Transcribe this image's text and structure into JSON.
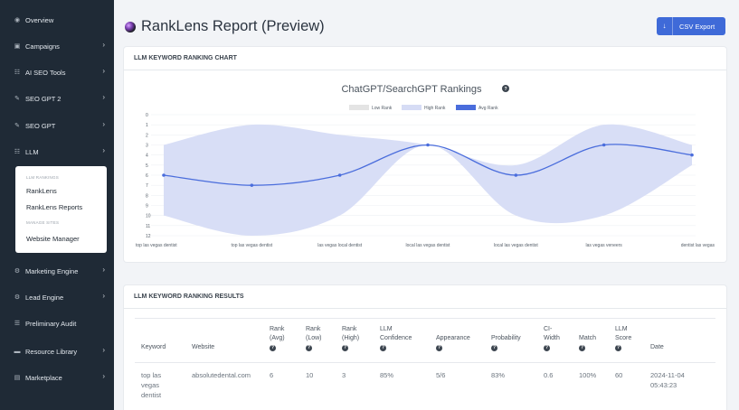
{
  "sidebar": {
    "items": [
      {
        "label": "Overview",
        "icon": "eye-icon"
      },
      {
        "label": "Campaigns",
        "icon": "briefcase-icon"
      },
      {
        "label": "AI SEO Tools",
        "icon": "sitemap-icon"
      },
      {
        "label": "SEO GPT 2",
        "icon": "edit-icon"
      },
      {
        "label": "SEO GPT",
        "icon": "edit-icon"
      },
      {
        "label": "LLM",
        "icon": "sitemap-icon"
      },
      {
        "label": "Marketing Engine",
        "icon": "gears-icon"
      },
      {
        "label": "Lead Engine",
        "icon": "gear-icon"
      },
      {
        "label": "Preliminary Audit",
        "icon": "list-icon"
      },
      {
        "label": "Resource Library",
        "icon": "folder-icon"
      },
      {
        "label": "Marketplace",
        "icon": "store-icon"
      }
    ],
    "submenu": {
      "header1": "LLM RANKINGS",
      "link1": "RankLens",
      "link2": "RankLens Reports",
      "header2": "MANAGE SITES",
      "link3": "Website Manager"
    }
  },
  "header": {
    "title": "RankLens Report (Preview)",
    "csv_label": "CSV Export"
  },
  "chart_card": {
    "title": "LLM KEYWORD RANKING CHART"
  },
  "chart_data": {
    "type": "line",
    "title": "ChatGPT/SearchGPT Rankings",
    "categories": [
      "top las vegas dentist",
      "top las vegas dentist",
      "las vegas local dentist",
      "local las vegas dentist",
      "local las vegas dentist",
      "las vegas veneers",
      "dentist las vegas"
    ],
    "series": [
      {
        "name": "Low Rank",
        "values": [
          3,
          1,
          2,
          3,
          5,
          1,
          3
        ]
      },
      {
        "name": "High Rank",
        "values": [
          10,
          12,
          10,
          3,
          10,
          10,
          5
        ]
      },
      {
        "name": "Avg Rank",
        "values": [
          6,
          7,
          6,
          3,
          6,
          3,
          4
        ]
      }
    ],
    "ylim": [
      0,
      12
    ],
    "y_reversed": true,
    "yticks": [
      "0",
      "1",
      "2",
      "3",
      "4",
      "5",
      "6",
      "7",
      "8",
      "9",
      "10",
      "11",
      "12"
    ],
    "legend_position": "top",
    "colors": {
      "low": "#e4e4e4",
      "high": "#d6dcf5",
      "avg": "#4a6ddc"
    }
  },
  "results_card": {
    "title": "LLM KEYWORD RANKING RESULTS",
    "headers": [
      {
        "l1": "",
        "l2": "",
        "l3": "Keyword"
      },
      {
        "l1": "",
        "l2": "",
        "l3": "Website"
      },
      {
        "l1": "Rank",
        "l2": "(Avg)",
        "l3": ""
      },
      {
        "l1": "Rank",
        "l2": "(Low)",
        "l3": ""
      },
      {
        "l1": "Rank",
        "l2": "(High)",
        "l3": ""
      },
      {
        "l1": "LLM",
        "l2": "Confidence",
        "l3": ""
      },
      {
        "l1": "",
        "l2": "Appearance",
        "l3": ""
      },
      {
        "l1": "",
        "l2": "Probability",
        "l3": ""
      },
      {
        "l1": "CI-",
        "l2": "Width",
        "l3": ""
      },
      {
        "l1": "",
        "l2": "Match",
        "l3": ""
      },
      {
        "l1": "LLM",
        "l2": "Score",
        "l3": ""
      },
      {
        "l1": "",
        "l2": "",
        "l3": "Date"
      }
    ],
    "rows": [
      {
        "keyword_l1": "top las",
        "keyword_l2": "vegas",
        "keyword_l3": "dentist",
        "website": "absolutedental.com",
        "rank_avg": "6",
        "rank_low": "10",
        "rank_high": "3",
        "confidence": "85%",
        "appearance": "5/6",
        "probability": "83%",
        "ci_width": "0.6",
        "match": "100%",
        "score": "60",
        "date_l1": "2024-11-04",
        "date_l2": "05:43:23"
      }
    ]
  }
}
